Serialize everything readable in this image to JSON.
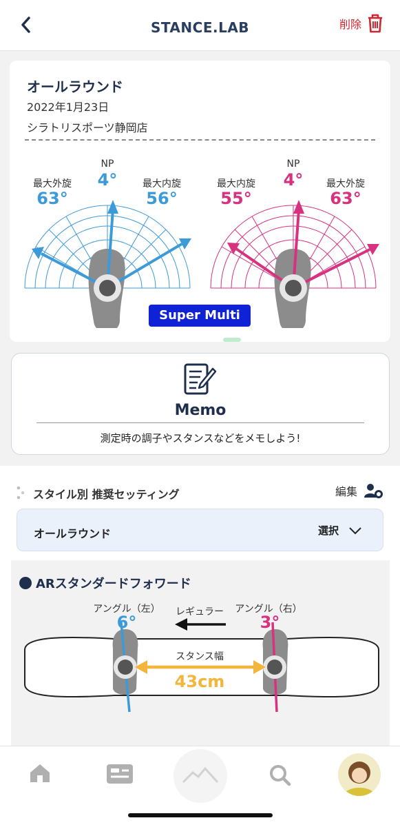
{
  "header": {
    "title": "STANCE.LAB",
    "delete_label": "削除"
  },
  "record": {
    "style": "オールラウンド",
    "date": "2022年1月23日",
    "shop": "シラトリスポーツ静岡店",
    "left": {
      "np_label": "NP",
      "np": "4°",
      "outer_label": "最大外旋",
      "outer": "63°",
      "inner_label": "最大内旋",
      "inner": "56°",
      "color": "#3d9ad8"
    },
    "right": {
      "np_label": "NP",
      "np": "4°",
      "inner_label": "最大内旋",
      "inner": "55°",
      "outer_label": "最大外旋",
      "outer": "63°",
      "color": "#d6327f"
    },
    "badge": "Super Multi"
  },
  "memo": {
    "title": "Memo",
    "hint": "測定時の調子やスタンスなどをメモしよう!"
  },
  "recommend": {
    "title": "スタイル別 推奨セッティング",
    "edit_label": "編集",
    "selected": "オールラウンド",
    "select_label": "選択",
    "setting_name": "ARスタンダードフォワード",
    "angle_left_label": "アングル（左）",
    "angle_left": "6°",
    "direction_label": "レギュラー",
    "angle_right_label": "アングル（右）",
    "angle_right": "3°",
    "width_label": "スタンス幅",
    "width": "43cm"
  },
  "colors": {
    "blue": "#3d9ad8",
    "pink": "#d6327f",
    "navy": "#1e2f4d",
    "red": "#d0272e",
    "yellow": "#f3b53b"
  },
  "tabs": [
    "home-icon",
    "card-icon",
    "mountain-icon",
    "search-icon",
    "avatar"
  ]
}
